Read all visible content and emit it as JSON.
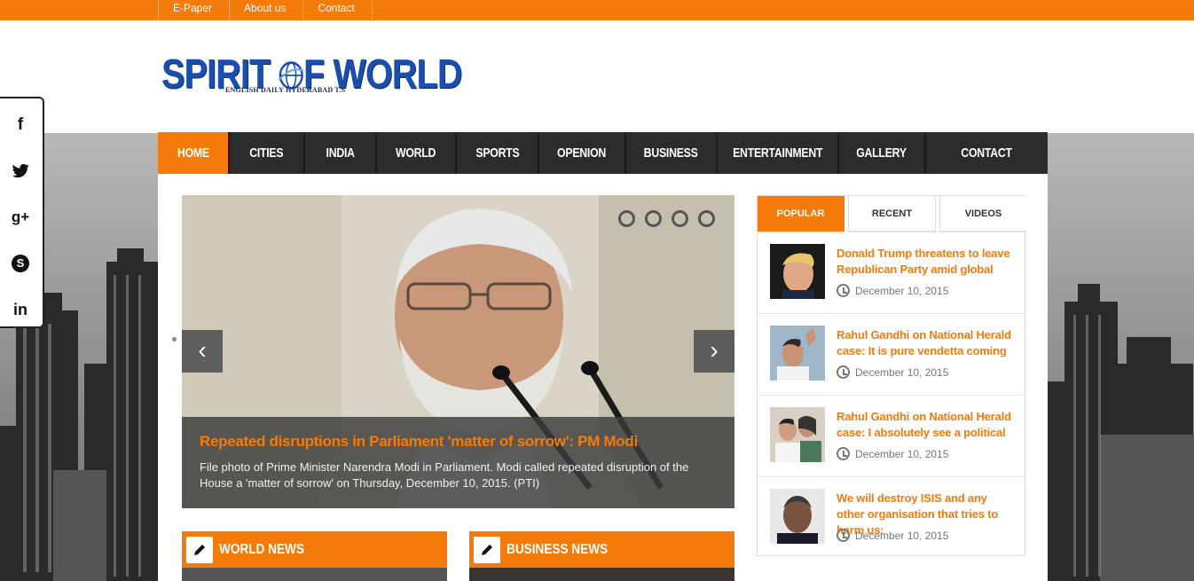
{
  "topbar": {
    "links": [
      "E-Paper",
      "About us",
      "Contact"
    ]
  },
  "logo": {
    "word1": "SPIRIT",
    "word2": "F WORLD",
    "tagline": "ENGLISH DAILY HYDERABAD T.S"
  },
  "social": {
    "icons": [
      "facebook-icon",
      "twitter-icon",
      "google-plus-icon",
      "skype-icon",
      "linkedin-icon"
    ],
    "glyphs": [
      "f",
      "t",
      "g+",
      "S",
      "in"
    ]
  },
  "nav": {
    "items": [
      "HOME",
      "CITIES",
      "INDIA",
      "WORLD",
      "SPORTS",
      "OPENION",
      "BUSINESS",
      "ENTERTAINMENT",
      "GALLERY",
      "CONTACT"
    ],
    "active": "HOME"
  },
  "slider": {
    "title": "Repeated disruptions in Parliament 'matter of sorrow': PM Modi",
    "caption": "File photo of Prime Minister Narendra Modi in Parliament. Modi called repeated disruption of the House a 'matter of sorrow' on Thursday, December 10, 2015. (PTI)",
    "prev_glyph": "‹",
    "next_glyph": "›"
  },
  "sections": {
    "world": "WORLD NEWS",
    "business": "BUSINESS NEWS"
  },
  "widget": {
    "tabs": [
      "POPULAR",
      "RECENT",
      "VIDEOS"
    ],
    "posts": [
      {
        "title": "Donald Trump threatens to leave Republican Party amid global",
        "date": "December 10, 2015"
      },
      {
        "title": "Rahul Gandhi on National Herald case: It is pure vendetta coming",
        "date": "December 10, 2015"
      },
      {
        "title": "Rahul Gandhi on National Herald case: I absolutely see a political",
        "date": "December 10, 2015"
      },
      {
        "title": "We will destroy ISIS and any other organisation that tries to harm us:",
        "date": "December 10, 2015"
      }
    ]
  },
  "colors": {
    "accent": "#f47b0a",
    "nav_bg": "#2c2c2c",
    "logo_blue": "#1a4fb0"
  }
}
